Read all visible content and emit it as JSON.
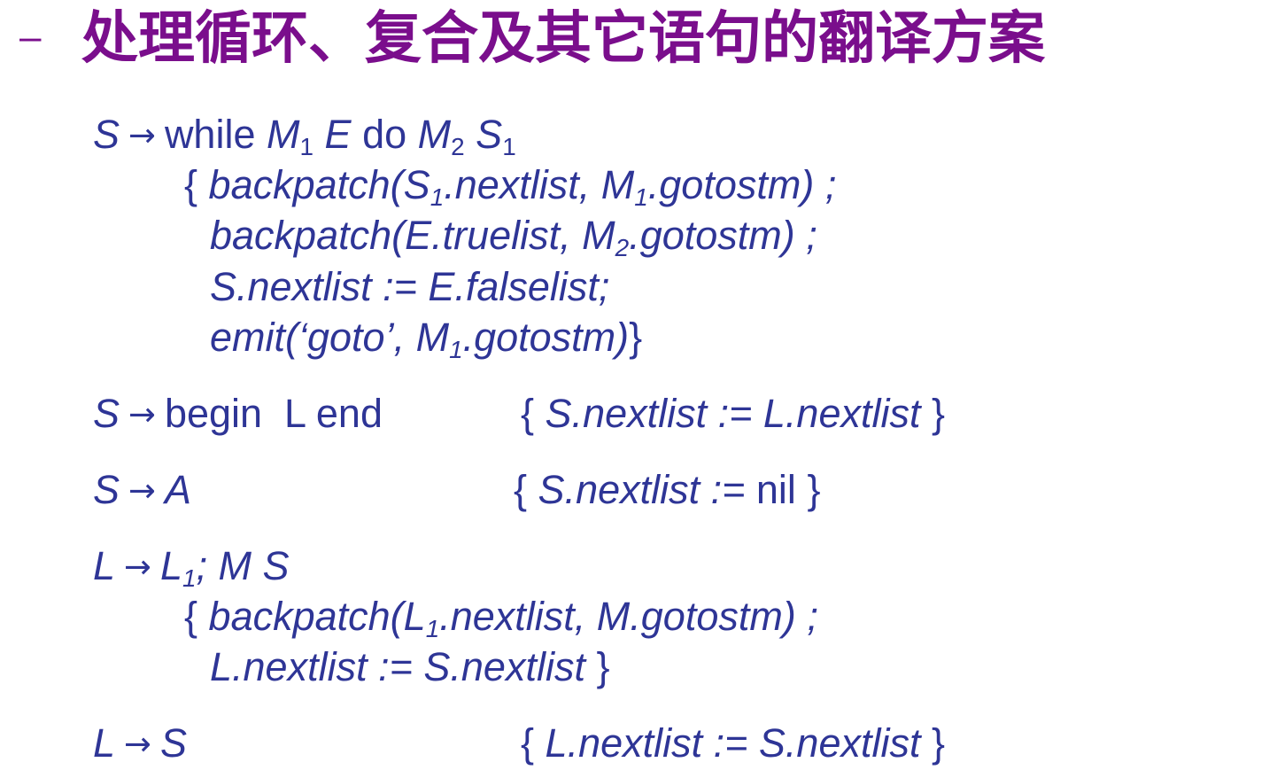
{
  "slide": {
    "bullet": "–",
    "title": "处理循环、复合及其它语句的翻译方案"
  },
  "rule_while": {
    "lhs": "S",
    "arrow": "→",
    "kw_while": "while",
    "m1": "M",
    "m1_sub": "1",
    "e": "E",
    "kw_do": "do",
    "m2": "M",
    "m2_sub": "2",
    "s1": "S",
    "s1_sub": "1",
    "a1_p1": "{ ",
    "a1_p2": "backpatch(S",
    "a1_sub1": "1",
    "a1_p3": ".nextlist, M",
    "a1_sub2": "1",
    "a1_p4": ".gotostm) ;",
    "a2_p1": "backpatch(E.truelist, M",
    "a2_sub": "2",
    "a2_p2": ".gotostm) ;",
    "a3": "S.nextlist := E.falselist;",
    "a4_p1": "emit(‘goto’, M",
    "a4_sub": "1",
    "a4_p2": ".gotostm)",
    "a4_close": "}"
  },
  "rule_begin": {
    "lhs": "S",
    "arrow": "→",
    "rhs": "begin  L end",
    "open": "{ ",
    "action": "S.nextlist := L.nextlist",
    "close": " }"
  },
  "rule_assign": {
    "lhs": "S",
    "arrow": "→",
    "rhs": "A",
    "open": "{ ",
    "action": "S.nextlist :=",
    "nil": " nil",
    "close": " }"
  },
  "rule_list": {
    "lhs": "L",
    "arrow": "→",
    "l1": "L",
    "l1_sub": "1",
    "rest": "; M S",
    "a1_open": "{ ",
    "a1_p1": "backpatch(L",
    "a1_sub": "1",
    "a1_p2": ".nextlist, M.gotostm) ;",
    "a2": "L.nextlist := S.nextlist",
    "a2_close": " }"
  },
  "rule_single": {
    "lhs": "L",
    "arrow": "→",
    "rhs": "S",
    "open": "{ ",
    "action": "L.nextlist := S.nextlist",
    "close": " }"
  },
  "colors": {
    "title": "#7A0E8C",
    "text": "#2E3596"
  }
}
